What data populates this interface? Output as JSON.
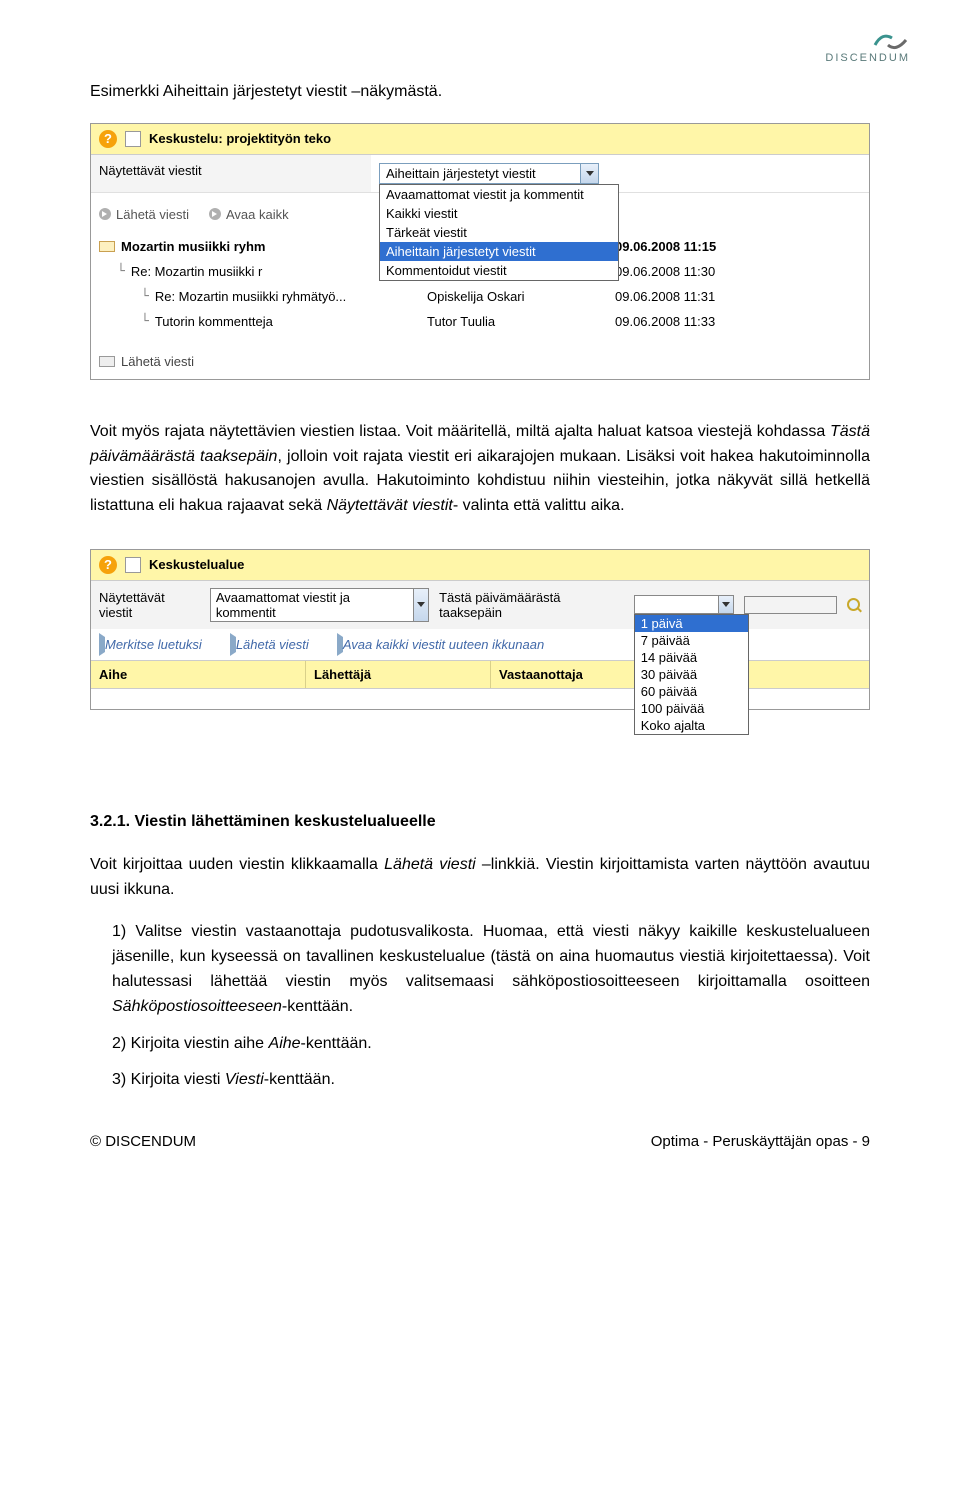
{
  "logo": {
    "brand": "DISCENDUM"
  },
  "p1": "Esimerkki Aiheittain järjestetyt viestit –näkymästä.",
  "screenshot1": {
    "title_prefix": "Keskustelu:",
    "title_topic": "projektityön teko",
    "filter_label": "Näytettävät viestit",
    "filter_selected": "Aiheittain järjestetyt viestit",
    "dropdown_options": [
      "Avaamattomat viestit ja kommentit",
      "Kaikki viestit",
      "Tärkeät viestit",
      "Aiheittain järjestetyt viestit",
      "Kommentoidut viestit"
    ],
    "selected_index": 3,
    "action_send": "Lähetä viesti",
    "action_open_all_partial": "Avaa kaikk",
    "threads": [
      {
        "indent": 0,
        "subject": "Mozartin musiikki ryhm",
        "sender_partial": "",
        "date": "09.06.2008 11:15",
        "bold": true,
        "unread": true
      },
      {
        "indent": 1,
        "subject": "Re: Mozartin musiikki r",
        "sender_partial": "",
        "date": "09.06.2008 11:30",
        "bold": false,
        "unread": false
      },
      {
        "indent": 2,
        "subject": "Re: Mozartin musiikki ryhmätyö...",
        "sender": "Opiskelija Oskari",
        "date": "09.06.2008 11:31",
        "bold": false,
        "unread": false
      },
      {
        "indent": 2,
        "subject": "Tutorin kommentteja",
        "sender": "Tutor Tuulia",
        "date": "09.06.2008 11:33",
        "bold": false,
        "unread": false
      }
    ],
    "footer_send": "Lähetä viesti"
  },
  "p2a": "Voit myös rajata näytettävien viestien listaa. Voit määritellä, miltä ajalta haluat katsoa viestejä kohdassa ",
  "p2_em1": "Tästä päivämäärästä taaksepäin",
  "p2b": ", jolloin voit rajata viestit eri aikarajojen mukaan. Lisäksi voit hakea hakutoiminnolla viestien sisällöstä hakusanojen avulla. Hakutoiminto kohdistuu niihin viesteihin, jotka näkyvät sillä hetkellä listattuna eli hakua rajaavat sekä ",
  "p2_em2": "Näytettävät viestit",
  "p2c": "- valinta että valittu aika.",
  "screenshot2": {
    "head_title": "Keskustelualue",
    "filter_label": "Näytettävät viestit",
    "filter1_value": "Avaamattomat viestit ja kommentit",
    "filter2_label": "Tästä päivämäärästä taaksepäin",
    "date_dropdown_options": [
      "1 päivä",
      "7 päivää",
      "14 päivää",
      "30 päivää",
      "60 päivää",
      "100 päivää",
      "Koko ajalta"
    ],
    "date_selected_index": 0,
    "link_mark_read": "Merkitse luetuksi",
    "link_send": "Lähetä viesti",
    "link_open_all": "Avaa kaikki viestit uuteen ikkunaan",
    "th_subject": "Aihe",
    "th_sender": "Lähettäjä",
    "th_recipient": "Vastaanottaja"
  },
  "h321": "3.2.1. Viestin lähettäminen keskustelualueelle",
  "p3a": "Voit kirjoittaa uuden viestin klikkaamalla ",
  "p3_em": "Lähetä viesti",
  "p3b": " –linkkiä. Viestin kirjoittamista varten näyttöön avautuu uusi ikkuna.",
  "li1a": "1) Valitse viestin vastaanottaja pudotusvalikosta. Huomaa, että viesti näkyy kaikille keskustelualueen jäsenille, kun kyseessä on tavallinen keskustelualue (tästä on aina huomautus viestiä kirjoitettaessa). Voit halutessasi lähettää viestin myös valitsemaasi sähköpostiosoitteeseen kirjoittamalla osoitteen ",
  "li1_em": "Sähköpostiosoitteeseen",
  "li1b": "-kenttään.",
  "li2a": "2) Kirjoita viestin aihe ",
  "li2_em": "Aihe",
  "li2b": "-kenttään.",
  "li3a": "3) Kirjoita viesti ",
  "li3_em": "Viesti",
  "li3b": "-kenttään.",
  "footer_left": "© DISCENDUM",
  "footer_right": "Optima - Peruskäyttäjän opas - 9"
}
